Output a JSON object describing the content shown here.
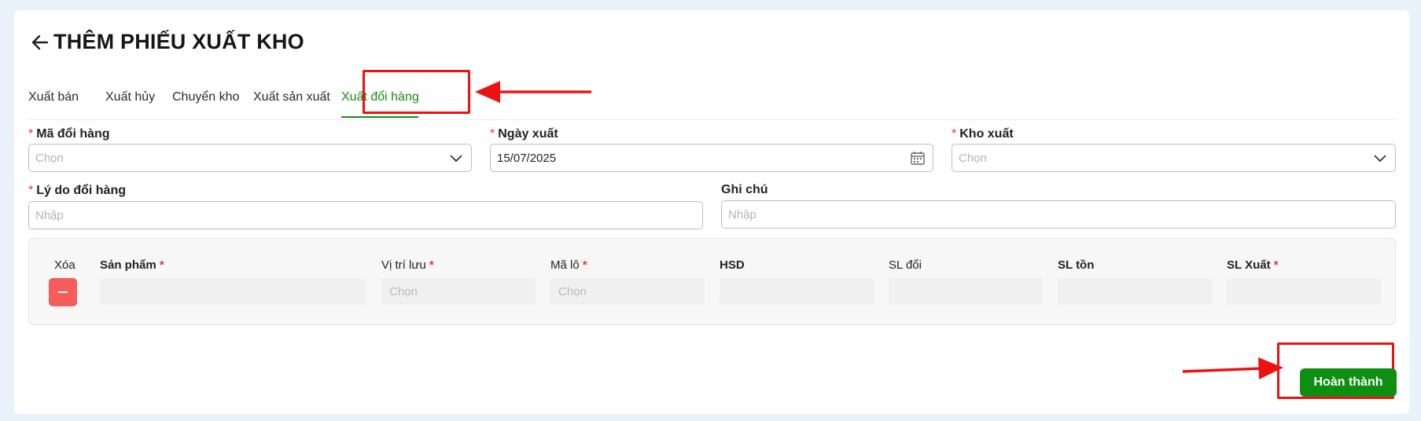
{
  "header": {
    "title": "THÊM PHIẾU XUẤT KHO"
  },
  "tabs": [
    {
      "label": "Xuất bán"
    },
    {
      "label": "Xuất hủy"
    },
    {
      "label": "Chuyển kho"
    },
    {
      "label": "Xuất sản xuất"
    },
    {
      "label": "Xuất đổi hàng",
      "active": true
    }
  ],
  "form": {
    "ma_doi_hang": {
      "label": "Mã đổi hàng",
      "placeholder": "Chọn",
      "icon": "chevron-down-icon"
    },
    "ngay_xuat": {
      "label": "Ngày xuất",
      "value": "15/07/2025",
      "icon": "calendar-icon"
    },
    "kho_xuat": {
      "label": "Kho xuất",
      "placeholder": "Chọn",
      "icon": "chevron-down-icon"
    },
    "ly_do": {
      "label": "Lý do đổi hàng",
      "placeholder": "Nhập"
    },
    "ghi_chu": {
      "label": "Ghi chú",
      "placeholder": "Nhập"
    }
  },
  "grid": {
    "columns": {
      "xoa": "Xóa",
      "san_pham": "Sản phẩm",
      "vi_tri": "Vị trí lưu",
      "ma_lo": "Mã lô",
      "hsd": "HSD",
      "sl_doi": "SL đổi",
      "sl_ton": "SL tồn",
      "sl_xuat": "SL Xuất"
    },
    "row": {
      "vi_tri_placeholder": "Chọn",
      "ma_lo_placeholder": "Chọn"
    }
  },
  "actions": {
    "done_label": "Hoàn thành"
  },
  "colors": {
    "accent": "#1a8a16",
    "button": "#0f8f11",
    "danger": "#f55c5c",
    "annotation": "#ee1111"
  }
}
